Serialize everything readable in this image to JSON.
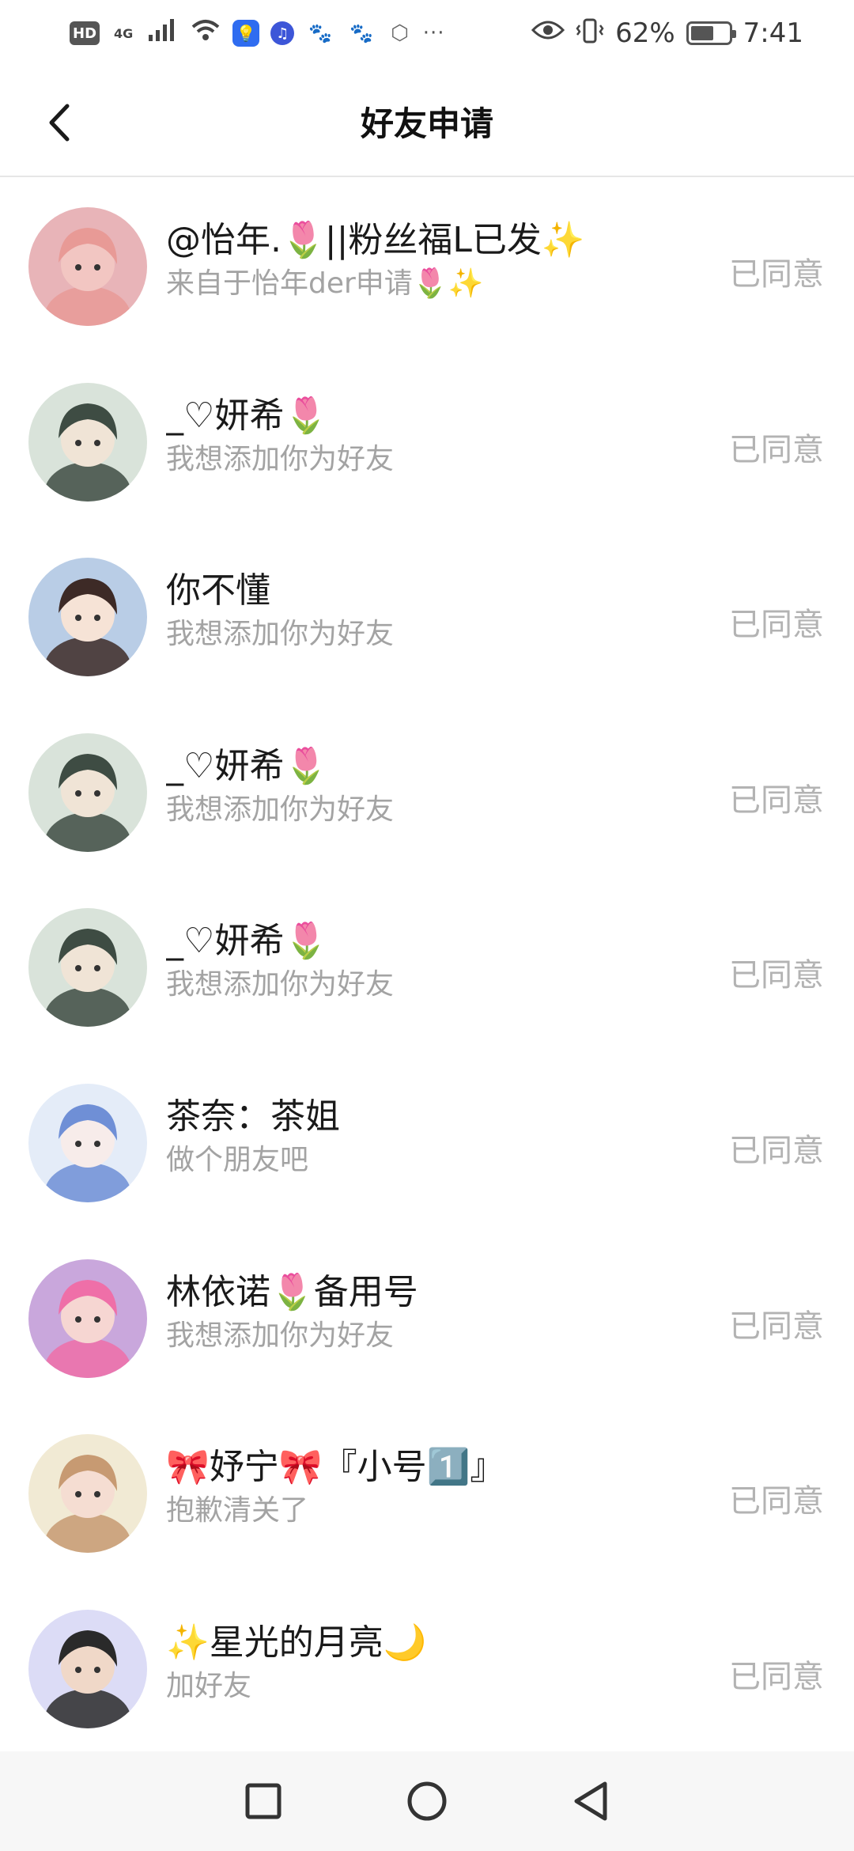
{
  "status_bar": {
    "hd": "HD",
    "network": "4G",
    "battery_percent": "62%",
    "battery_level": 0.62,
    "time": "7:41",
    "more": "···",
    "icons": [
      "hd-icon",
      "signal-icon",
      "wifi-icon",
      "bulb-app-icon",
      "music-app-icon",
      "paw-app-icon",
      "paw-app-icon",
      "hexagon-app-icon",
      "more-icon",
      "eye-icon",
      "vibrate-icon",
      "battery-icon"
    ]
  },
  "header": {
    "title": "好友申请",
    "back_icon": "back-arrow-icon"
  },
  "requests": [
    {
      "name": "@怡年.🌷||粉丝福L已发✨",
      "message": "来自于怡年der申请🌷✨",
      "status": "已同意",
      "avatar_bg": "#e8b4b8",
      "avatar_fg": "#f2c6c2",
      "avatar_hair": "#e89a96"
    },
    {
      "name": "_♡妍希🌷",
      "message": "我想添加你为好友",
      "status": "已同意",
      "avatar_bg": "#d9e3da",
      "avatar_fg": "#f0e4d6",
      "avatar_hair": "#3e4c43"
    },
    {
      "name": "你不懂",
      "message": "我想添加你为好友",
      "status": "已同意",
      "avatar_bg": "#b9cde6",
      "avatar_fg": "#f6e3d6",
      "avatar_hair": "#3d2a26"
    },
    {
      "name": "_♡妍希🌷",
      "message": "我想添加你为好友",
      "status": "已同意",
      "avatar_bg": "#d9e3da",
      "avatar_fg": "#f0e4d6",
      "avatar_hair": "#3e4c43"
    },
    {
      "name": "_♡妍希🌷",
      "message": "我想添加你为好友",
      "status": "已同意",
      "avatar_bg": "#d9e3da",
      "avatar_fg": "#f0e4d6",
      "avatar_hair": "#3e4c43"
    },
    {
      "name": "茶奈：茶姐",
      "message": "做个朋友吧",
      "status": "已同意",
      "avatar_bg": "#e4ecf8",
      "avatar_fg": "#f7ecea",
      "avatar_hair": "#6f8fd6"
    },
    {
      "name": "林依诺🌷备用号",
      "message": "我想添加你为好友",
      "status": "已同意",
      "avatar_bg": "#c9a7dc",
      "avatar_fg": "#f6d6d2",
      "avatar_hair": "#ef6fa8"
    },
    {
      "name": "🎀妤宁🎀『小号1️⃣』",
      "message": "抱歉清关了",
      "status": "已同意",
      "avatar_bg": "#f1ead4",
      "avatar_fg": "#f5ddd2",
      "avatar_hair": "#c79a72"
    },
    {
      "name": "✨星光的月亮🌙",
      "message": "加好友",
      "status": "已同意",
      "avatar_bg": "#dcdcf6",
      "avatar_fg": "#f0d8c8",
      "avatar_hair": "#2a2a2a"
    }
  ],
  "nav_bar": {
    "icons": [
      "recents-square-icon",
      "home-circle-icon",
      "back-triangle-icon"
    ]
  }
}
